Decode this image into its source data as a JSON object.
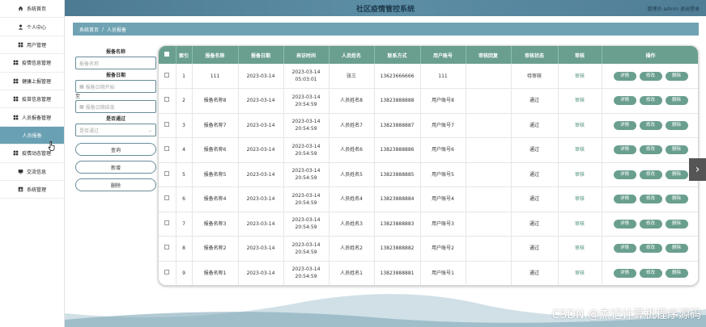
{
  "sidebar": {
    "items": [
      {
        "label": "系统首页",
        "icon": "home-icon"
      },
      {
        "label": "个人中心",
        "icon": "person-icon"
      },
      {
        "label": "用户管理",
        "icon": "grid-icon"
      },
      {
        "label": "疫情信息管理",
        "icon": "grid-icon"
      },
      {
        "label": "健康上报管理",
        "icon": "grid-icon"
      },
      {
        "label": "疫苗信息管理",
        "icon": "grid-icon"
      },
      {
        "label": "人员报备管理",
        "icon": "grid-icon"
      },
      {
        "label": "人员报备",
        "icon": "",
        "active": true
      },
      {
        "label": "疫情动态管理",
        "icon": "grid-icon"
      },
      {
        "label": "交流信息",
        "icon": "monitor-icon"
      },
      {
        "label": "系统管理",
        "icon": "chart-icon"
      }
    ]
  },
  "header": {
    "title": "社区疫情管控系统",
    "user_text": "管理员 admin  退出登录"
  },
  "breadcrumb": {
    "home": "系统首页",
    "separator": "/",
    "current": "人员报备"
  },
  "search": {
    "name_label": "报备名称",
    "name_placeholder": "报备名称",
    "date_label": "报备日期",
    "date_start_placeholder": "报备日期开始",
    "date_to": "至",
    "date_end_placeholder": "报备日期结束",
    "pass_label": "是否通过",
    "pass_placeholder": "是否通过",
    "query_btn": "查询",
    "add_btn": "新增",
    "delete_btn": "删除"
  },
  "table": {
    "headers": [
      "索引",
      "报备名称",
      "报备日期",
      "来访时间",
      "人员姓名",
      "联系方式",
      "用户账号",
      "审核回复",
      "审核状态",
      "审核",
      "操作"
    ],
    "ops": {
      "detail": "详情",
      "edit": "修改",
      "delete": "删除"
    },
    "rows": [
      {
        "index": "1",
        "name": "111",
        "date": "2023-03-14",
        "visit": "2023-03-14 05:03:01",
        "person": "张三",
        "phone": "13623666666",
        "account": "111",
        "reply": "",
        "status": "待审核",
        "audit": "审核"
      },
      {
        "index": "2",
        "name": "报备名称8",
        "date": "2023-03-14",
        "visit": "2023-03-14 20:54:59",
        "person": "人员姓名8",
        "phone": "13823888888",
        "account": "用户账号8",
        "reply": "",
        "status": "通过",
        "audit": "审核"
      },
      {
        "index": "3",
        "name": "报备名称7",
        "date": "2023-03-14",
        "visit": "2023-03-14 20:54:59",
        "person": "人员姓名7",
        "phone": "13823888887",
        "account": "用户账号7",
        "reply": "",
        "status": "通过",
        "audit": "审核"
      },
      {
        "index": "4",
        "name": "报备名称6",
        "date": "2023-03-14",
        "visit": "2023-03-14 20:54:59",
        "person": "人员姓名6",
        "phone": "13823888886",
        "account": "用户账号6",
        "reply": "",
        "status": "通过",
        "audit": "审核"
      },
      {
        "index": "5",
        "name": "报备名称5",
        "date": "2023-03-14",
        "visit": "2023-03-14 20:54:59",
        "person": "人员姓名5",
        "phone": "13823888885",
        "account": "用户账号5",
        "reply": "",
        "status": "通过",
        "audit": "审核"
      },
      {
        "index": "6",
        "name": "报备名称4",
        "date": "2023-03-14",
        "visit": "2023-03-14 20:54:59",
        "person": "人员姓名4",
        "phone": "13823888884",
        "account": "用户账号4",
        "reply": "",
        "status": "通过",
        "audit": "审核"
      },
      {
        "index": "7",
        "name": "报备名称3",
        "date": "2023-03-14",
        "visit": "2023-03-14 20:54:59",
        "person": "人员姓名3",
        "phone": "13823888883",
        "account": "用户账号3",
        "reply": "",
        "status": "通过",
        "audit": "审核"
      },
      {
        "index": "8",
        "name": "报备名称2",
        "date": "2023-03-14",
        "visit": "2023-03-14 20:54:59",
        "person": "人员姓名2",
        "phone": "13823888882",
        "account": "用户账号2",
        "reply": "",
        "status": "通过",
        "audit": "审核"
      },
      {
        "index": "9",
        "name": "报备名称1",
        "date": "2023-03-14",
        "visit": "2023-03-14 20:54:59",
        "person": "人员姓名1",
        "phone": "13823888881",
        "account": "用户账号1",
        "reply": "",
        "status": "通过",
        "audit": "审核"
      }
    ]
  },
  "edge_toggle": "›",
  "watermark": "CSDN @杰记计算机程序源码",
  "colors": {
    "header": "#5c8ea6",
    "table_header": "#6a9f8f",
    "active_sidebar": "#6aa0b3",
    "button": "#6a9f8f"
  }
}
